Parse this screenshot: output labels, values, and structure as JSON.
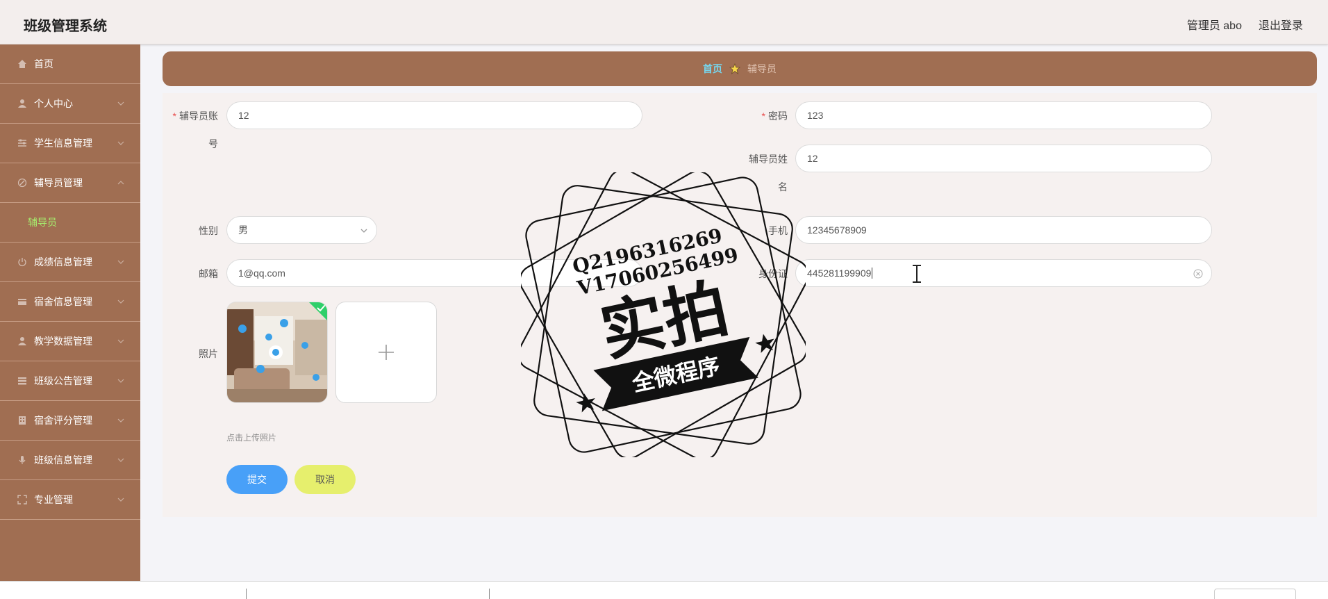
{
  "header": {
    "title": "班级管理系统",
    "admin_label": "管理员 abo",
    "logout_label": "退出登录"
  },
  "sidebar": {
    "items": [
      {
        "label": "首页",
        "icon": "home-icon"
      },
      {
        "label": "个人中心",
        "icon": "user-icon"
      },
      {
        "label": "学生信息管理",
        "icon": "sliders-icon"
      },
      {
        "label": "辅导员管理",
        "icon": "edit-icon"
      },
      {
        "label": "辅导员",
        "icon": ""
      },
      {
        "label": "成绩信息管理",
        "icon": "power-icon"
      },
      {
        "label": "宿舍信息管理",
        "icon": "card-icon"
      },
      {
        "label": "教学数据管理",
        "icon": "user-icon"
      },
      {
        "label": "班级公告管理",
        "icon": "list-icon"
      },
      {
        "label": "宿舍评分管理",
        "icon": "building-icon"
      },
      {
        "label": "班级信息管理",
        "icon": "mic-icon"
      },
      {
        "label": "专业管理",
        "icon": "fullscreen-icon"
      }
    ]
  },
  "breadcrumb": {
    "home": "首页",
    "current": "辅导员"
  },
  "form": {
    "account": {
      "label_a": "辅导员账",
      "label_b": "号",
      "value": "12"
    },
    "password": {
      "label": "密码",
      "value": "123"
    },
    "name": {
      "label_a": "辅导员姓",
      "label_b": "名",
      "value": "12"
    },
    "gender": {
      "label": "性别",
      "value": "男"
    },
    "phone": {
      "label": "手机",
      "value": "12345678909"
    },
    "email": {
      "label": "邮箱",
      "value": "1@qq.com"
    },
    "idcard": {
      "label": "身份证",
      "value": "445281199909"
    },
    "photo": {
      "label": "照片",
      "hint": "点击上传照片"
    },
    "submit_label": "提交",
    "cancel_label": "取消"
  },
  "watermark": {
    "line1": "Q2196316269",
    "line2": "V17060256499",
    "main": "实拍",
    "ribbon": "全微程序"
  },
  "colors": {
    "sidebar": "#a06e52",
    "header": "#f3eeed",
    "submit": "#48a0f8",
    "cancel": "#e6ef6d",
    "active_submenu": "#a6f06e",
    "breadcrumb_home": "#76d6ee"
  }
}
